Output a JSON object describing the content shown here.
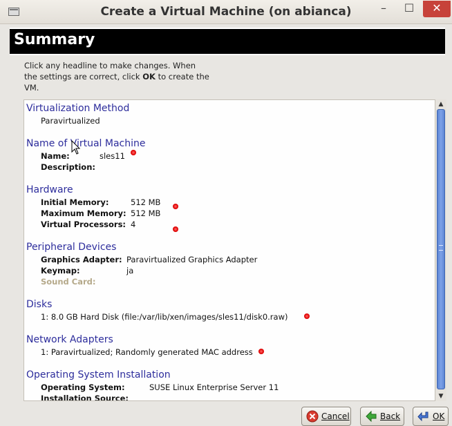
{
  "window": {
    "title": "Create a Virtual Machine (on abianca)",
    "min_label": "–",
    "max_label": "☐",
    "close_label": "✕"
  },
  "header": {
    "title": "Summary"
  },
  "intro": {
    "line1": "Click any headline to make changes.  When",
    "line2a": "the settings are correct, click ",
    "line2b": "OK",
    "line2c": " to create the",
    "line3": "VM."
  },
  "sections": {
    "virtualization": {
      "heading": "Virtualization Method",
      "value": "Paravirtualized"
    },
    "name": {
      "heading": "Name of Virtual Machine",
      "name_label": "Name:",
      "name_value": "sles11",
      "desc_label": "Description:",
      "desc_value": ""
    },
    "hardware": {
      "heading": "Hardware",
      "initmem_label": "Initial Memory:",
      "initmem_value": "512 MB",
      "maxmem_label": "Maximum Memory:",
      "maxmem_value": "512 MB",
      "vcpu_label": "Virtual Processors:",
      "vcpu_value": "4"
    },
    "peripheral": {
      "heading": "Peripheral Devices",
      "graphics_label": "Graphics Adapter:",
      "graphics_value": "Paravirtualized Graphics Adapter",
      "keymap_label": "Keymap:",
      "keymap_value": "ja",
      "sound_label": "Sound Card:"
    },
    "disks": {
      "heading": "Disks",
      "value": "1: 8.0 GB Hard Disk (file:/var/lib/xen/images/sles11/disk0.raw)"
    },
    "network": {
      "heading": "Network Adapters",
      "value": "1: Paravirtualized; Randomly generated MAC address"
    },
    "os": {
      "heading": "Operating System Installation",
      "os_label": "Operating System:",
      "os_value": "SUSE Linux Enterprise Server 11",
      "source_label": "Installation Source:"
    }
  },
  "buttons": {
    "cancel": "Cancel",
    "back": "Back",
    "ok": "OK"
  },
  "colors": {
    "heading": "#2d2d9c",
    "marker": "#e00000",
    "scroll_thumb": "#5c85d4",
    "close": "#c7423a"
  }
}
